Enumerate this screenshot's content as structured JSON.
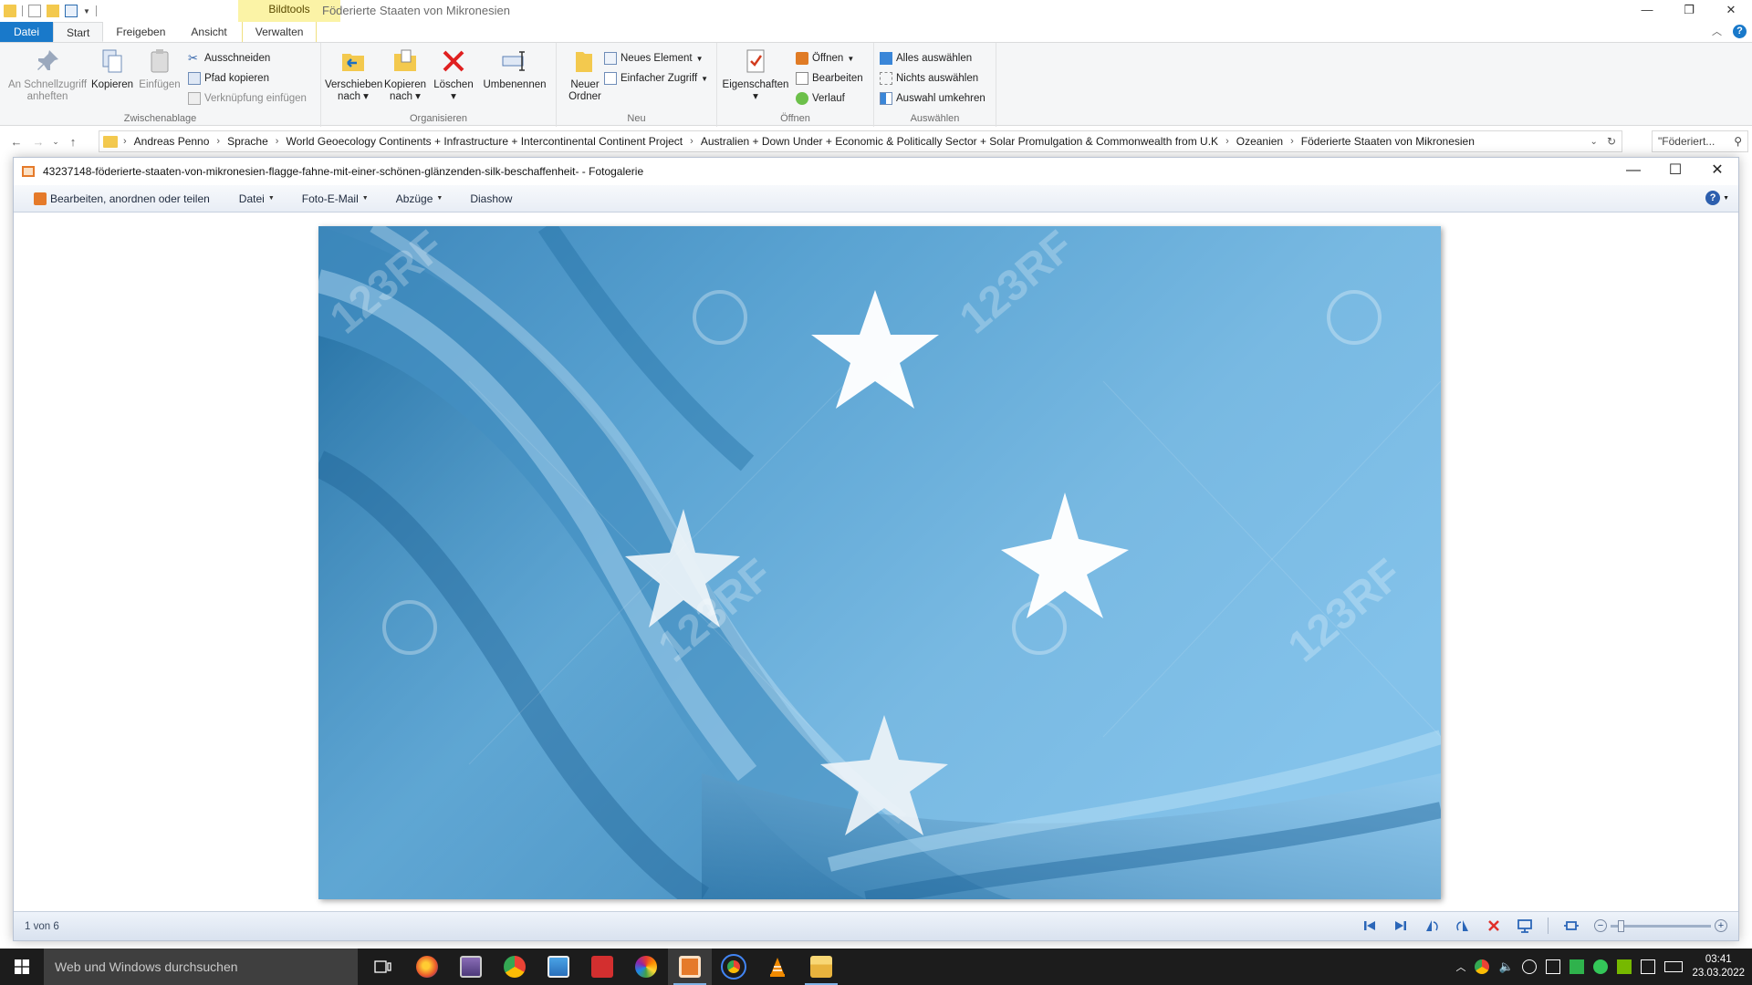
{
  "explorer": {
    "context_tab": "Bildtools",
    "window_title": "Föderierte Staaten von Mikronesien",
    "tabs": [
      "Datei",
      "Start",
      "Freigeben",
      "Ansicht",
      "Verwalten"
    ],
    "ribbon": {
      "clipboard": {
        "label": "Zwischenablage",
        "pin": "An Schnellzugriff anheften",
        "copy": "Kopieren",
        "paste": "Einfügen",
        "cut": "Ausschneiden",
        "copy_path": "Pfad kopieren",
        "paste_shortcut": "Verknüpfung einfügen"
      },
      "organize": {
        "label": "Organisieren",
        "move_to": "Verschieben nach",
        "copy_to": "Kopieren nach",
        "delete": "Löschen",
        "rename": "Umbenennen"
      },
      "new": {
        "label": "Neu",
        "new_folder": "Neuer Ordner",
        "new_item": "Neues Element",
        "easy_access": "Einfacher Zugriff"
      },
      "open": {
        "label": "Öffnen",
        "properties": "Eigenschaften",
        "open": "Öffnen",
        "edit": "Bearbeiten",
        "history": "Verlauf"
      },
      "select": {
        "label": "Auswählen",
        "select_all": "Alles auswählen",
        "select_none": "Nichts auswählen",
        "invert": "Auswahl umkehren"
      }
    },
    "breadcrumb": [
      "Andreas Penno",
      "Sprache",
      "World Geoecology Continents + Infrastructure + Intercontinental Continent Project",
      "Australien + Down Under + Economic & Politically Sector + Solar Promulgation & Commonwealth from U.K",
      "Ozeanien",
      "Föderierte Staaten von Mikronesien"
    ],
    "search_placeholder": "\"Föderiert..."
  },
  "gallery": {
    "title": "43237148-föderierte-staaten-von-mikronesien-flagge-fahne-mit-einer-schönen-glänzenden-silk-beschaffenheit- - Fotogalerie",
    "menu": [
      "Bearbeiten, anordnen oder teilen",
      "Datei",
      "Foto-E-Mail",
      "Abzüge",
      "Diashow"
    ],
    "status": "1 von 6",
    "watermark": "123RF",
    "colors": {
      "flag_blue": "#75b2dc",
      "star": "#ffffff"
    }
  },
  "taskbar": {
    "search_placeholder": "Web und Windows durchsuchen",
    "time": "03:41",
    "date": "23.03.2022"
  }
}
